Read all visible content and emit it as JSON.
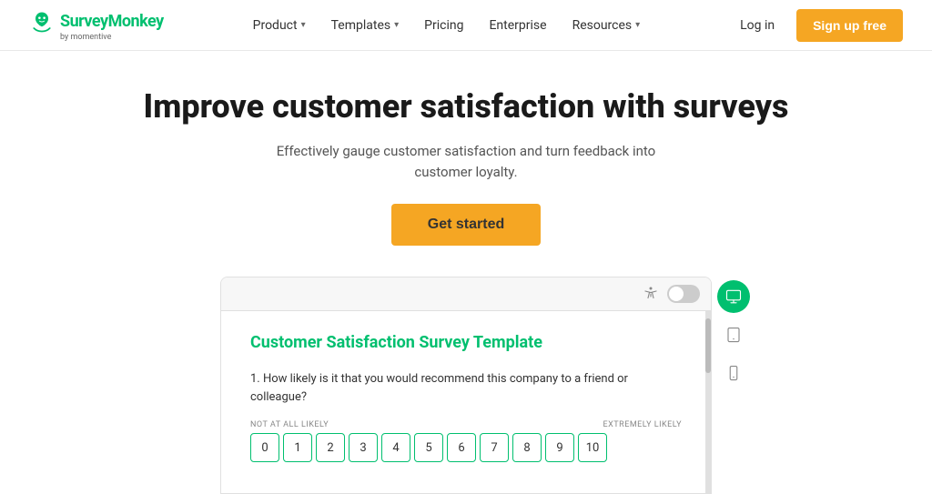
{
  "header": {
    "logo_text": "SurveyMonkey",
    "logo_sub": "by momentive",
    "nav": [
      {
        "label": "Product",
        "has_dropdown": true
      },
      {
        "label": "Templates",
        "has_dropdown": true
      },
      {
        "label": "Pricing",
        "has_dropdown": false
      },
      {
        "label": "Enterprise",
        "has_dropdown": false
      },
      {
        "label": "Resources",
        "has_dropdown": true
      }
    ],
    "login_label": "Log in",
    "signup_label": "Sign up free"
  },
  "hero": {
    "title": "Improve customer satisfaction with surveys",
    "subtitle": "Effectively gauge customer satisfaction and turn feedback into customer loyalty.",
    "cta_label": "Get started"
  },
  "preview": {
    "survey_title": "Customer Satisfaction Survey Template",
    "question": "1. How likely is it that you would recommend this company to a friend or colleague?",
    "scale_low": "NOT AT ALL LIKELY",
    "scale_high": "EXTREMELY LIKELY",
    "scale_numbers": [
      "0",
      "1",
      "2",
      "3",
      "4",
      "5",
      "6",
      "7",
      "8",
      "9",
      "10"
    ]
  },
  "devices": [
    {
      "label": "desktop",
      "active": true
    },
    {
      "label": "tablet",
      "active": false
    },
    {
      "label": "mobile",
      "active": false
    }
  ]
}
